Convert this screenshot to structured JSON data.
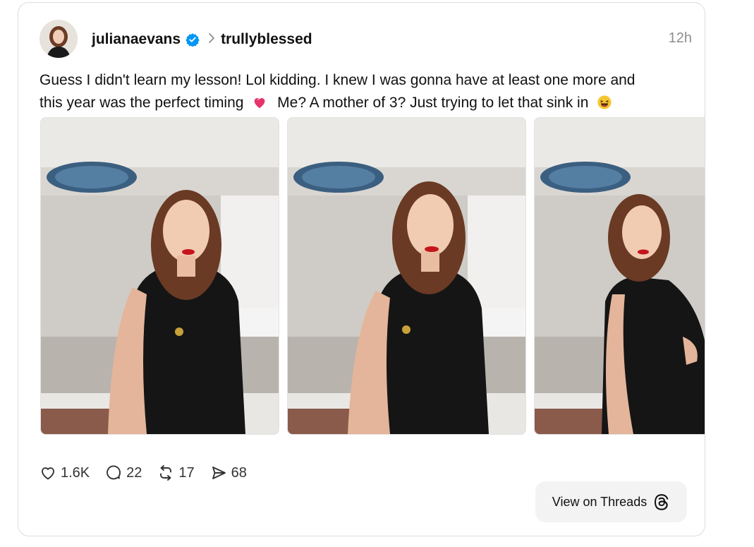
{
  "post": {
    "username": "julianaevans",
    "reply_to": "trullyblessed",
    "timestamp": "12h",
    "text_line1": "Guess I didn't learn my lesson! Lol kidding. I knew I was gonna have at least one more and",
    "text_line2a": "this year was the perfect timing",
    "text_line2b": "Me? A mother of 3? Just trying to let that sink in",
    "emoji_1": "heart-emoji",
    "emoji_2": "laughing-emoji"
  },
  "photos": [
    {
      "name": "photo-1",
      "description": "woman in black sleeveless top"
    },
    {
      "name": "photo-2",
      "description": "woman in black sleeveless top"
    },
    {
      "name": "photo-3",
      "description": "woman in black sleeveless top side profile"
    }
  ],
  "actions": {
    "likes": "1.6K",
    "replies": "22",
    "reposts": "17",
    "shares": "68"
  },
  "view_button": {
    "label": "View on Threads"
  },
  "colors": {
    "verified": "#0095f6",
    "text": "#111111",
    "muted": "#8e8e8e",
    "button_bg": "#f3f3f3"
  }
}
